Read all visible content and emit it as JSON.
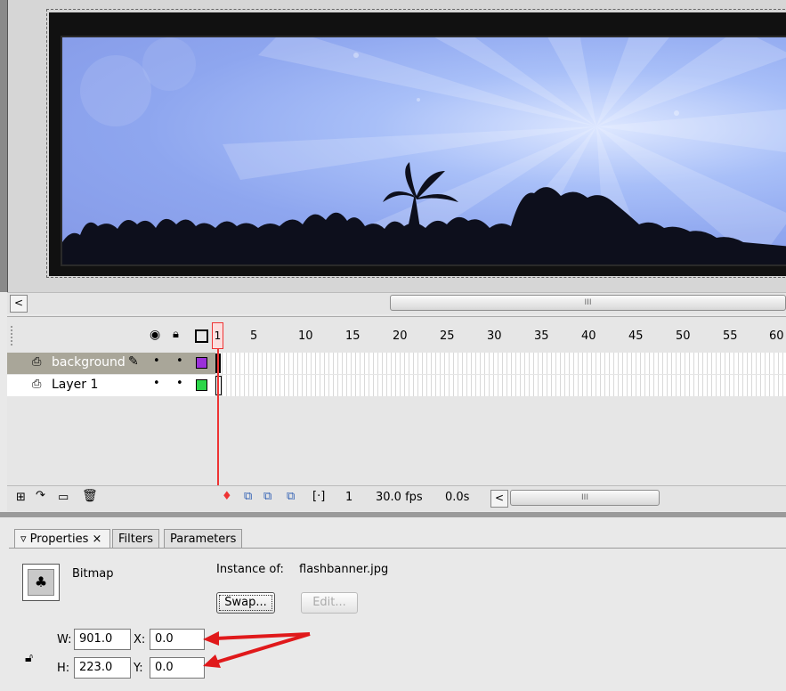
{
  "stage": {
    "scroll_left": "<",
    "scroll_thumb": "III"
  },
  "timeline": {
    "frame_numbers": [
      "1",
      "5",
      "10",
      "15",
      "20",
      "25",
      "30",
      "35",
      "40",
      "45",
      "50",
      "55",
      "60"
    ],
    "layers": [
      {
        "name": "background",
        "color": "#9b30d9",
        "selected": true
      },
      {
        "name": "Layer 1",
        "color": "#2cd64a",
        "selected": false
      }
    ],
    "current_frame": "1",
    "fps": "30.0 fps",
    "elapsed": "0.0s",
    "scroll_left": "<",
    "scroll_thumb": "III"
  },
  "properties": {
    "tabs": [
      "Properties",
      "Filters",
      "Parameters"
    ],
    "tab_close": "×",
    "type_label": "Bitmap",
    "instance_label": "Instance of:",
    "instance_value": "flashbanner.jpg",
    "swap_label": "Swap...",
    "edit_label": "Edit...",
    "w_label": "W:",
    "w_value": "901.0",
    "h_label": "H:",
    "h_value": "223.0",
    "x_label": "X:",
    "x_value": "0.0",
    "y_label": "Y:",
    "y_value": "0.0",
    "annotation_color": "#e0191b"
  }
}
